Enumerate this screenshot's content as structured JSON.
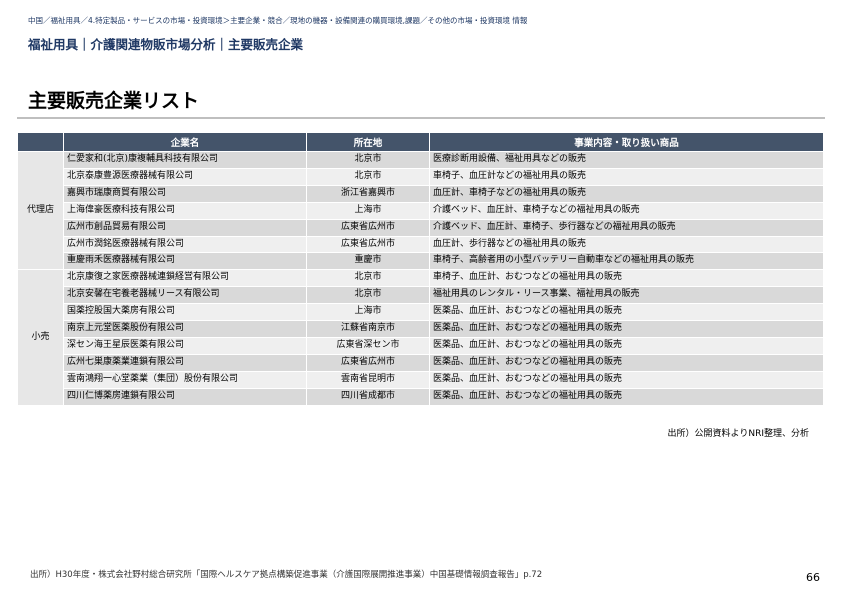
{
  "breadcrumb": "中国／福祉用具／4.特定製品・サービスの市場・投資環境＞主要企業・競合／現地の機器・設備関連の購買環境,課題／その他の市場・投資環境 情報",
  "subtitle": "福祉用具｜介護関連物販市場分析｜主要販売企業",
  "page_title": "主要販売企業リスト",
  "table": {
    "headers": [
      "",
      "企業名",
      "所在地",
      "事業内容・取り扱い商品"
    ],
    "groups": [
      {
        "category": "代理店",
        "rows": [
          {
            "company": "仁愛家和(北京)康複輔具科技有限公司",
            "location": "北京市",
            "business": "医療診断用設備、福祉用具などの販売"
          },
          {
            "company": "北京泰康豊源医療器械有限公司",
            "location": "北京市",
            "business": "車椅子、血圧計などの福祉用具の販売"
          },
          {
            "company": "嘉興市瑞康商貿有限公司",
            "location": "浙江省嘉興市",
            "business": "血圧計、車椅子などの福祉用具の販売"
          },
          {
            "company": "上海偉豪医療科技有限公司",
            "location": "上海市",
            "business": "介護ベッド、血圧計、車椅子などの福祉用具の販売"
          },
          {
            "company": "広州市創品貿易有限公司",
            "location": "広東省広州市",
            "business": "介護ベッド、血圧計、車椅子、歩行器などの福祉用具の販売"
          },
          {
            "company": "広州市潤銘医療器械有限公司",
            "location": "広東省広州市",
            "business": "血圧計、歩行器などの福祉用具の販売"
          },
          {
            "company": "重慶雨禾医療器械有限公司",
            "location": "重慶市",
            "business": "車椅子、高齢者用の小型バッテリー自動車などの福祉用具の販売"
          }
        ]
      },
      {
        "category": "小売",
        "rows": [
          {
            "company": "北京康復之家医療器械連鎖経営有限公司",
            "location": "北京市",
            "business": "車椅子、血圧計、おむつなどの福祉用具の販売"
          },
          {
            "company": "北京安馨在宅養老器械リース有限公司",
            "location": "北京市",
            "business": "福祉用具のレンタル・リース事業、福祉用具の販売"
          },
          {
            "company": "国薬控股国大薬房有限公司",
            "location": "上海市",
            "business": "医薬品、血圧計、おむつなどの福祉用具の販売"
          },
          {
            "company": "南京上元堂医薬股份有限公司",
            "location": "江蘇省南京市",
            "business": "医薬品、血圧計、おむつなどの福祉用具の販売"
          },
          {
            "company": "深セン海王星辰医薬有限公司",
            "location": "広東省深セン市",
            "business": "医薬品、血圧計、おむつなどの福祉用具の販売"
          },
          {
            "company": "広州七巣康薬業連鎖有限公司",
            "location": "広東省広州市",
            "business": "医薬品、血圧計、おむつなどの福祉用具の販売"
          },
          {
            "company": "雲南鴻翔一心堂薬業（集団）股份有限公司",
            "location": "雲南省昆明市",
            "business": "医薬品、血圧計、おむつなどの福祉用具の販売"
          },
          {
            "company": "四川仁博薬房連鎖有限公司",
            "location": "四川省成都市",
            "business": "医薬品、血圧計、おむつなどの福祉用具の販売"
          }
        ]
      }
    ]
  },
  "source_note": "出所）公開資料よりNRI整理、分析",
  "footer_source": "出所）H30年度・株式会社野村総合研究所「国際ヘルスケア拠点構築促進事業（介護国際展開推進事業）中国基礎情報調査報告」p.72",
  "page_number": "66"
}
